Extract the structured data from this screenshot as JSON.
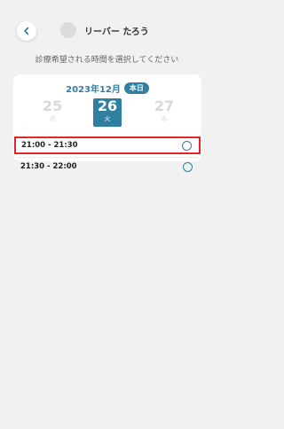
{
  "header": {
    "user_name": "リーバー たろう"
  },
  "instruction": "診療希望される時間を選択してください",
  "calendar": {
    "year_month": "2023年12月",
    "today_badge": "本日",
    "days": [
      {
        "num": "25",
        "weekday": "月"
      },
      {
        "num": "26",
        "weekday": "火"
      },
      {
        "num": "27",
        "weekday": "水"
      }
    ]
  },
  "slots": [
    {
      "time": "21:00 - 21:30"
    },
    {
      "time": "21:30 - 22:00"
    }
  ],
  "colors": {
    "accent": "#2e7fa0",
    "highlight": "#e0252b",
    "background": "#f1f1f1"
  }
}
